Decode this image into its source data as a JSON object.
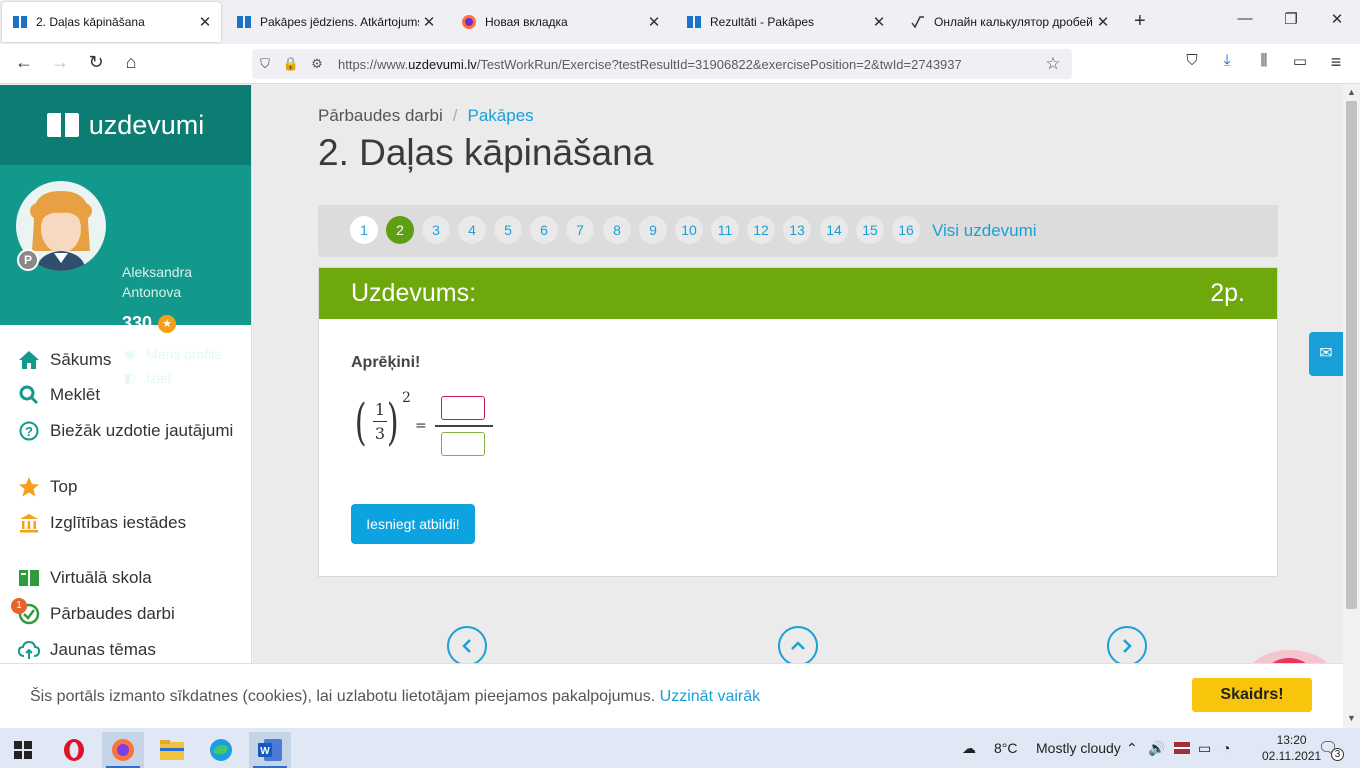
{
  "browser": {
    "tabs": [
      {
        "title": "2. Daļas kāpināšana",
        "icon": "uzdevumi-book-icon"
      },
      {
        "title": "Pakāpes jēdziens. Atkārtojums -",
        "icon": "uzdevumi-book-icon"
      },
      {
        "title": "Новая вкладка",
        "icon": "firefox-icon"
      },
      {
        "title": "Rezultāti - Pakāpes",
        "icon": "uzdevumi-book-icon"
      },
      {
        "title": "Онлайн калькулятор дробей. I",
        "icon": "calculator-icon"
      }
    ],
    "url_prefix": "https://www.",
    "url_domain": "uzdevumi.lv",
    "url_rest": "/TestWorkRun/Exercise?testResultId=31906822&exercisePosition=2&twId=2743937"
  },
  "site": {
    "logo_text": "uzdevumi",
    "user_name_line1": "Aleksandra",
    "user_name_line2": "Antonova",
    "points": "330",
    "badge_letter": "P",
    "profile_link": "Mans profils",
    "logout_link": "Iziet",
    "menu": [
      {
        "label": "Sākums",
        "icon": "home-icon"
      },
      {
        "label": "Meklēt",
        "icon": "search-icon"
      },
      {
        "label": "Biežāk uzdotie jautājumi",
        "icon": "question-icon"
      },
      {
        "label": "Top",
        "icon": "star-icon"
      },
      {
        "label": "Izglītības iestādes",
        "icon": "institution-icon"
      },
      {
        "label": "Virtuālā skola",
        "icon": "book-icon"
      },
      {
        "label": "Pārbaudes darbi",
        "icon": "check-icon",
        "badge": "1"
      },
      {
        "label": "Jaunas tēmas",
        "icon": "cloud-icon"
      }
    ]
  },
  "page": {
    "breadcrumb_root": "Pārbaudes darbi",
    "breadcrumb_current": "Pakāpes",
    "title": "2. Daļas kāpināšana",
    "pager": [
      "1",
      "2",
      "3",
      "4",
      "5",
      "6",
      "7",
      "8",
      "9",
      "10",
      "11",
      "12",
      "13",
      "14",
      "15",
      "16"
    ],
    "pager_current": "2",
    "all_tasks": "Visi uzdevumi",
    "task_header": "Uzdevums:",
    "task_points": "2p.",
    "instruction": "Aprēķini!",
    "numerator": "1",
    "denominator": "3",
    "exponent": "2",
    "equals": "=",
    "submit": "Iesniegt atbildi!"
  },
  "cookie": {
    "text": "Šis portāls izmanto sīkdatnes (cookies), lai uzlabotu lietotājam pieejamos pakalpojumus.",
    "link": "Uzzināt vairāk",
    "button": "Skaidrs!"
  },
  "taskbar": {
    "weather_temp": "8°C",
    "weather_text": "Mostly cloudy",
    "time": "13:20",
    "date": "02.11.2021",
    "notification_count": "3"
  },
  "colors": {
    "teal_dark": "#0c7d73",
    "teal": "#13998b",
    "green": "#6fa80c",
    "blue": "#1aa0d8",
    "yellow": "#f8c40c"
  }
}
